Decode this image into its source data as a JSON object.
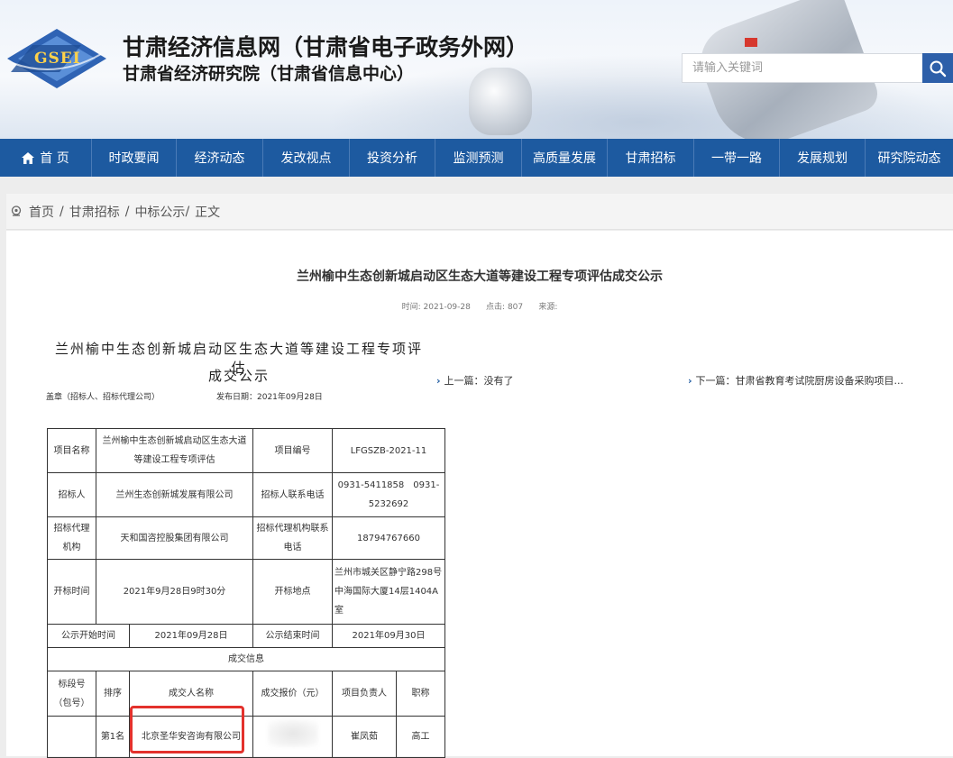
{
  "header": {
    "logo_text": "GSEI",
    "title": "甘肃经济信息网（甘肃省电子政务外网）",
    "subtitle": "甘肃省经济研究院（甘肃省信息中心）",
    "search_placeholder": "请输入关键词"
  },
  "nav": {
    "items": [
      {
        "label": "首 页",
        "icon": "home-icon"
      },
      {
        "label": "时政要闻"
      },
      {
        "label": "经济动态"
      },
      {
        "label": "发改视点"
      },
      {
        "label": "投资分析"
      },
      {
        "label": "监测预测"
      },
      {
        "label": "高质量发展"
      },
      {
        "label": "甘肃招标"
      },
      {
        "label": "一带一路"
      },
      {
        "label": "发展规划"
      },
      {
        "label": "研究院动态"
      }
    ]
  },
  "breadcrumb": {
    "items": [
      "首页",
      "甘肃招标",
      "中标公示",
      "正文"
    ]
  },
  "article": {
    "title": "兰州榆中生态创新城启动区生态大道等建设工程专项评估成交公示",
    "meta_time_label": "时间:",
    "meta_time": "2021-09-28",
    "meta_clicks_label": "点击:",
    "meta_clicks": "807",
    "meta_source_label": "来源:",
    "doc_heading_line1": "兰州榆中生态创新城启动区生态大道等建设工程专项评估",
    "doc_heading_line2": "成交公示",
    "doc_issuer": "盖章（招标人、招标代理公司）",
    "doc_date": "发布日期：2021年09月28日",
    "prev_label": "上一篇：没有了",
    "next_label": "下一篇：甘肃省教育考试院厨房设备采购项目..."
  },
  "table": {
    "project_name_label": "项目名称",
    "project_name": "兰州榆中生态创新城启动区生态大道等建设工程专项评估",
    "project_no_label": "项目编号",
    "project_no": "LFGSZB-2021-11",
    "tenderer_label": "招标人",
    "tenderer": "兰州生态创新城发展有限公司",
    "tenderer_phone_label": "招标人联系电话",
    "tenderer_phone": "0931-5411858　0931-5232692",
    "agency_label": "招标代理机构",
    "agency": "天和国咨控股集团有限公司",
    "agency_phone_label": "招标代理机构联系电话",
    "agency_phone": "18794767660",
    "open_time_label": "开标时间",
    "open_time": "2021年9月28日9时30分",
    "open_place_label": "开标地点",
    "open_place": "兰州市城关区静宁路298号中海国际大厦14层1404A室",
    "notice_start_label": "公示开始时间",
    "notice_start": "2021年09月28日",
    "notice_end_label": "公示结束时间",
    "notice_end": "2021年09月30日",
    "result_section": "成交信息",
    "col_lot": "标段号（包号）",
    "col_rank": "排序",
    "col_winner": "成交人名称",
    "col_price": "成交报价（元）",
    "col_manager": "项目负责人",
    "col_title": "职称",
    "row_rank": "第1名",
    "row_winner": "北京圣华安咨询有限公司",
    "row_manager": "崔凤茹",
    "row_title": "高工"
  }
}
